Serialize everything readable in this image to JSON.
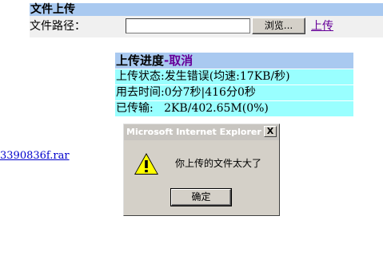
{
  "form": {
    "header": "文件上传",
    "path_label": "文件路径：",
    "path_value": "",
    "browse_label": "浏览...",
    "upload_link": "上传"
  },
  "progress": {
    "header_prefix": "上传进度",
    "header_sep": "-",
    "cancel_label": "取消",
    "status": "上传状态:发生错误(均速:17KB/秒)",
    "time": "用去时间:0分7秒|416分0秒",
    "transferred": "已传输:   2KB/402.65M(0%)"
  },
  "file_link": "3390836f.rar",
  "dialog": {
    "title": "Microsoft Internet Explorer",
    "close": "X",
    "icon": "warning-icon",
    "message": "你上传的文件太大了",
    "ok_label": "确定"
  },
  "colors": {
    "header_bg": "#a9c9f0",
    "progress_bg": "#99ffff",
    "link_visited": "#660099",
    "link": "#0000cc",
    "dialog_bg": "#d4d0c8"
  }
}
